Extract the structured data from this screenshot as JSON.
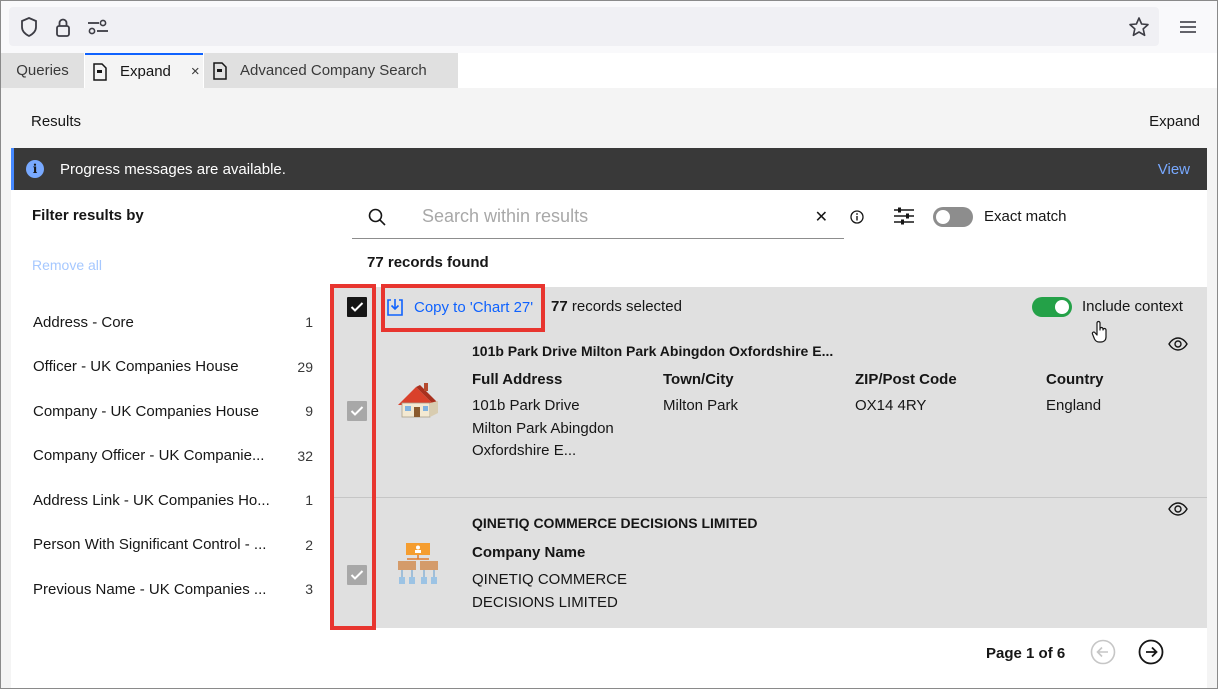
{
  "browser": {
    "icons": [
      "shield-icon",
      "lock-icon",
      "permissions-icon",
      "star-icon",
      "hamburger-menu-icon"
    ]
  },
  "tabs": [
    {
      "label": "Queries",
      "active": false
    },
    {
      "label": "Expand",
      "active": true,
      "closable": true
    },
    {
      "label": "Advanced Company Search",
      "active": false
    }
  ],
  "header": {
    "title": "Results",
    "right_label": "Expand"
  },
  "notice": {
    "text": "Progress messages are available.",
    "action": "View"
  },
  "filter": {
    "title": "Filter results by",
    "remove_all": "Remove all",
    "items": [
      {
        "label": "Address - Core",
        "count": "1"
      },
      {
        "label": "Officer - UK Companies House",
        "count": "29"
      },
      {
        "label": "Company - UK Companies House",
        "count": "9"
      },
      {
        "label": "Company Officer - UK Companie...",
        "count": "32"
      },
      {
        "label": "Address Link - UK Companies Ho...",
        "count": "1"
      },
      {
        "label": "Person With Significant Control - ...",
        "count": "2"
      },
      {
        "label": "Previous Name - UK Companies ...",
        "count": "3"
      }
    ]
  },
  "search": {
    "placeholder": "Search within results",
    "value": "",
    "exact_match_label": "Exact match",
    "exact_match_on": false
  },
  "results": {
    "records_found": "77 records found",
    "copy_label": "Copy to 'Chart 27'",
    "selected_count": "77",
    "selected_suffix": " records selected",
    "include_context_label": "Include context",
    "include_context_on": true,
    "records": [
      {
        "title": "101b Park Drive Milton Park Abingdon Oxfordshire E...",
        "icon": "house-icon",
        "fields": [
          {
            "label": "Full Address",
            "lines": [
              "101b Park Drive",
              "Milton Park Abingdon",
              "Oxfordshire E..."
            ]
          },
          {
            "label": "Town/City",
            "lines": [
              "Milton Park"
            ]
          },
          {
            "label": "ZIP/Post Code",
            "lines": [
              "OX14 4RY"
            ]
          },
          {
            "label": "Country",
            "lines": [
              "England"
            ]
          }
        ]
      },
      {
        "title": "QINETIQ COMMERCE DECISIONS LIMITED",
        "icon": "org-chart-icon",
        "fields": [
          {
            "label": "Company Name",
            "lines": [
              "QINETIQ COMMERCE",
              "DECISIONS LIMITED"
            ]
          }
        ]
      }
    ]
  },
  "pagination": {
    "label": "Page 1 of 6"
  },
  "colors": {
    "annotation": "#e8352f",
    "accent": "#0f62fe",
    "toggle_on": "#24a148"
  }
}
